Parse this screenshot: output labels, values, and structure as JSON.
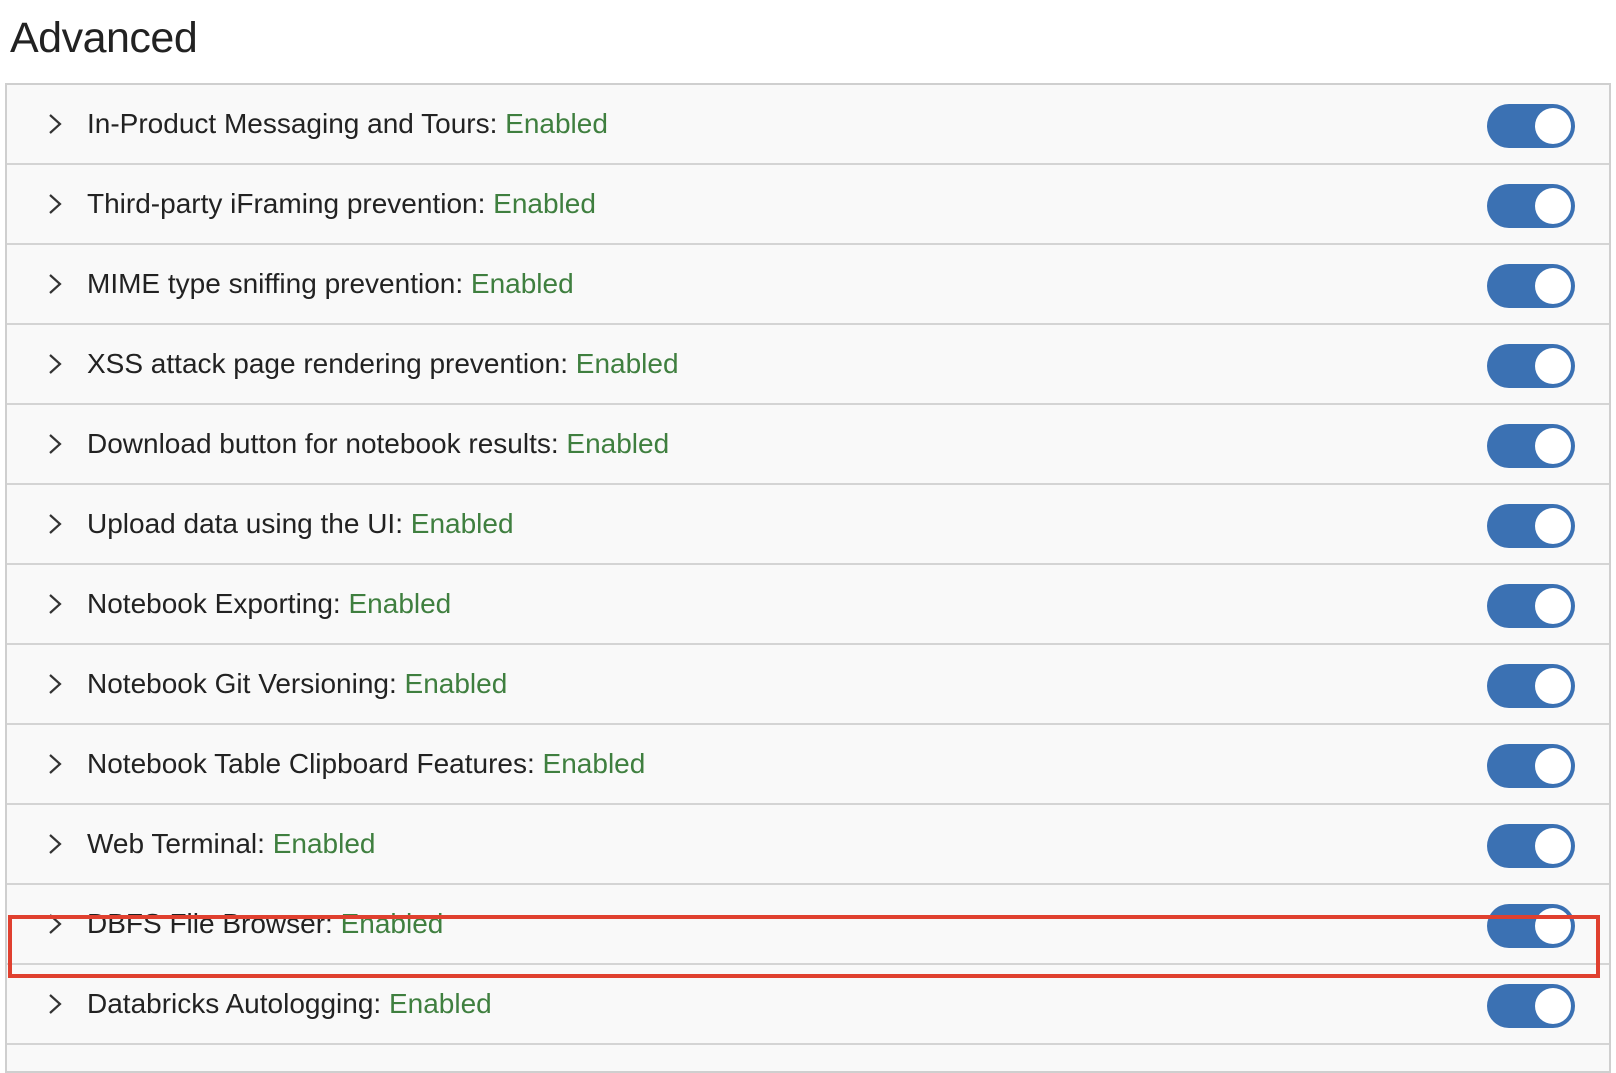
{
  "page": {
    "title": "Advanced"
  },
  "settings": [
    {
      "name": "In-Product Messaging and Tours:",
      "status": "Enabled",
      "enabled": true
    },
    {
      "name": "Third-party iFraming prevention:",
      "status": "Enabled",
      "enabled": true
    },
    {
      "name": "MIME type sniffing prevention:",
      "status": "Enabled",
      "enabled": true
    },
    {
      "name": "XSS attack page rendering prevention:",
      "status": "Enabled",
      "enabled": true
    },
    {
      "name": "Download button for notebook results:",
      "status": "Enabled",
      "enabled": true
    },
    {
      "name": "Upload data using the UI:",
      "status": "Enabled",
      "enabled": true
    },
    {
      "name": "Notebook Exporting:",
      "status": "Enabled",
      "enabled": true
    },
    {
      "name": "Notebook Git Versioning:",
      "status": "Enabled",
      "enabled": true
    },
    {
      "name": "Notebook Table Clipboard Features:",
      "status": "Enabled",
      "enabled": true
    },
    {
      "name": "Web Terminal:",
      "status": "Enabled",
      "enabled": true
    },
    {
      "name": "DBFS File Browser:",
      "status": "Enabled",
      "enabled": true,
      "highlighted": true
    },
    {
      "name": "Databricks Autologging:",
      "status": "Enabled",
      "enabled": true
    }
  ],
  "colors": {
    "status_text": "#3f7f3f",
    "toggle_on": "#3b71b3",
    "highlight_border": "#e0402f"
  },
  "icons": {
    "expand": "chevron-right-icon"
  }
}
